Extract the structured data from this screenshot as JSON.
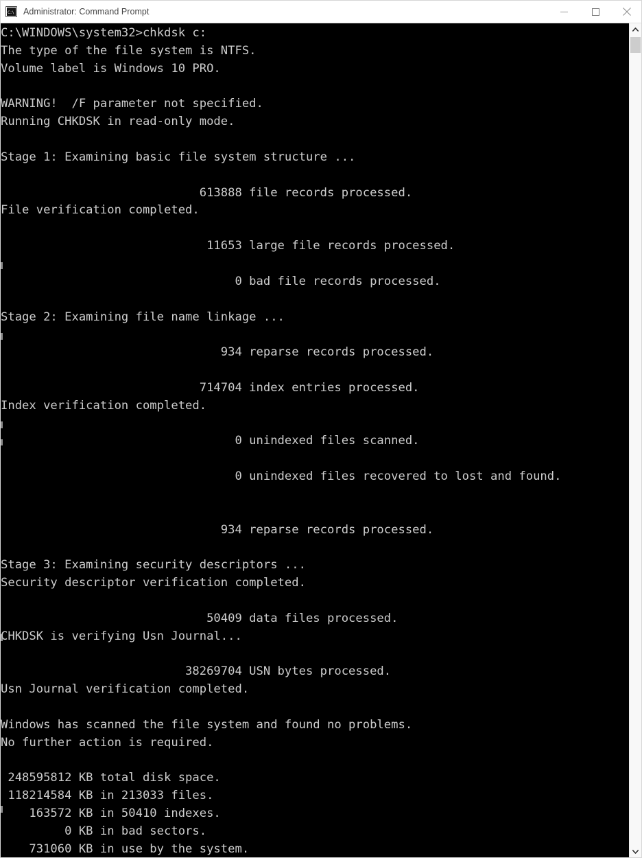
{
  "window": {
    "title": "Administrator: Command Prompt",
    "icon": "command-prompt-icon",
    "icon_glyph": "C:\\",
    "background_color": "#000000",
    "titlebar_color": "#ffffff",
    "text_color": "#cccccc"
  },
  "controls": {
    "minimize_label": "Minimize",
    "maximize_label": "Maximize",
    "close_label": "Close"
  },
  "scrollbar": {
    "up_arrow": "scroll-up-arrow",
    "down_arrow": "scroll-down-arrow",
    "thumb": "scrollbar-thumb"
  },
  "console": {
    "prompt": "C:\\WINDOWS\\system32>",
    "command": "chkdsk c:",
    "lines": [
      "C:\\WINDOWS\\system32>chkdsk c:",
      "The type of the file system is NTFS.",
      "Volume label is Windows 10 PRO.",
      "",
      "WARNING!  /F parameter not specified.",
      "Running CHKDSK in read-only mode.",
      "",
      "Stage 1: Examining basic file system structure ...",
      "",
      "                            613888 file records processed.",
      "File verification completed.",
      "",
      "                             11653 large file records processed.",
      "",
      "                                 0 bad file records processed.",
      "",
      "Stage 2: Examining file name linkage ...",
      "",
      "                               934 reparse records processed.",
      "",
      "                            714704 index entries processed.",
      "Index verification completed.",
      "",
      "                                 0 unindexed files scanned.",
      "",
      "                                 0 unindexed files recovered to lost and found.",
      "",
      "",
      "                               934 reparse records processed.",
      "",
      "Stage 3: Examining security descriptors ...",
      "Security descriptor verification completed.",
      "",
      "                             50409 data files processed.",
      "CHKDSK is verifying Usn Journal...",
      "",
      "                          38269704 USN bytes processed.",
      "Usn Journal verification completed.",
      "",
      "Windows has scanned the file system and found no problems.",
      "No further action is required.",
      "",
      " 248595812 KB total disk space.",
      " 118214584 KB in 213033 files.",
      "    163572 KB in 50410 indexes.",
      "         0 KB in bad sectors.",
      "    731060 KB in use by the system."
    ],
    "stats": {
      "file_records_processed": 613888,
      "large_file_records_processed": 11653,
      "bad_file_records_processed": 0,
      "reparse_records_processed": 934,
      "index_entries_processed": 714704,
      "unindexed_files_scanned": 0,
      "unindexed_files_recovered": 0,
      "data_files_processed": 50409,
      "usn_bytes_processed": 38269704,
      "total_disk_space_kb": 248595812,
      "kb_in_files": 118214584,
      "file_count": 213033,
      "kb_in_indexes": 163572,
      "index_count": 50410,
      "kb_in_bad_sectors": 0,
      "kb_in_use_by_system": 731060
    },
    "file_system": "NTFS",
    "volume_label": "Windows 10 PRO",
    "result": "Windows has scanned the file system and found no problems."
  }
}
